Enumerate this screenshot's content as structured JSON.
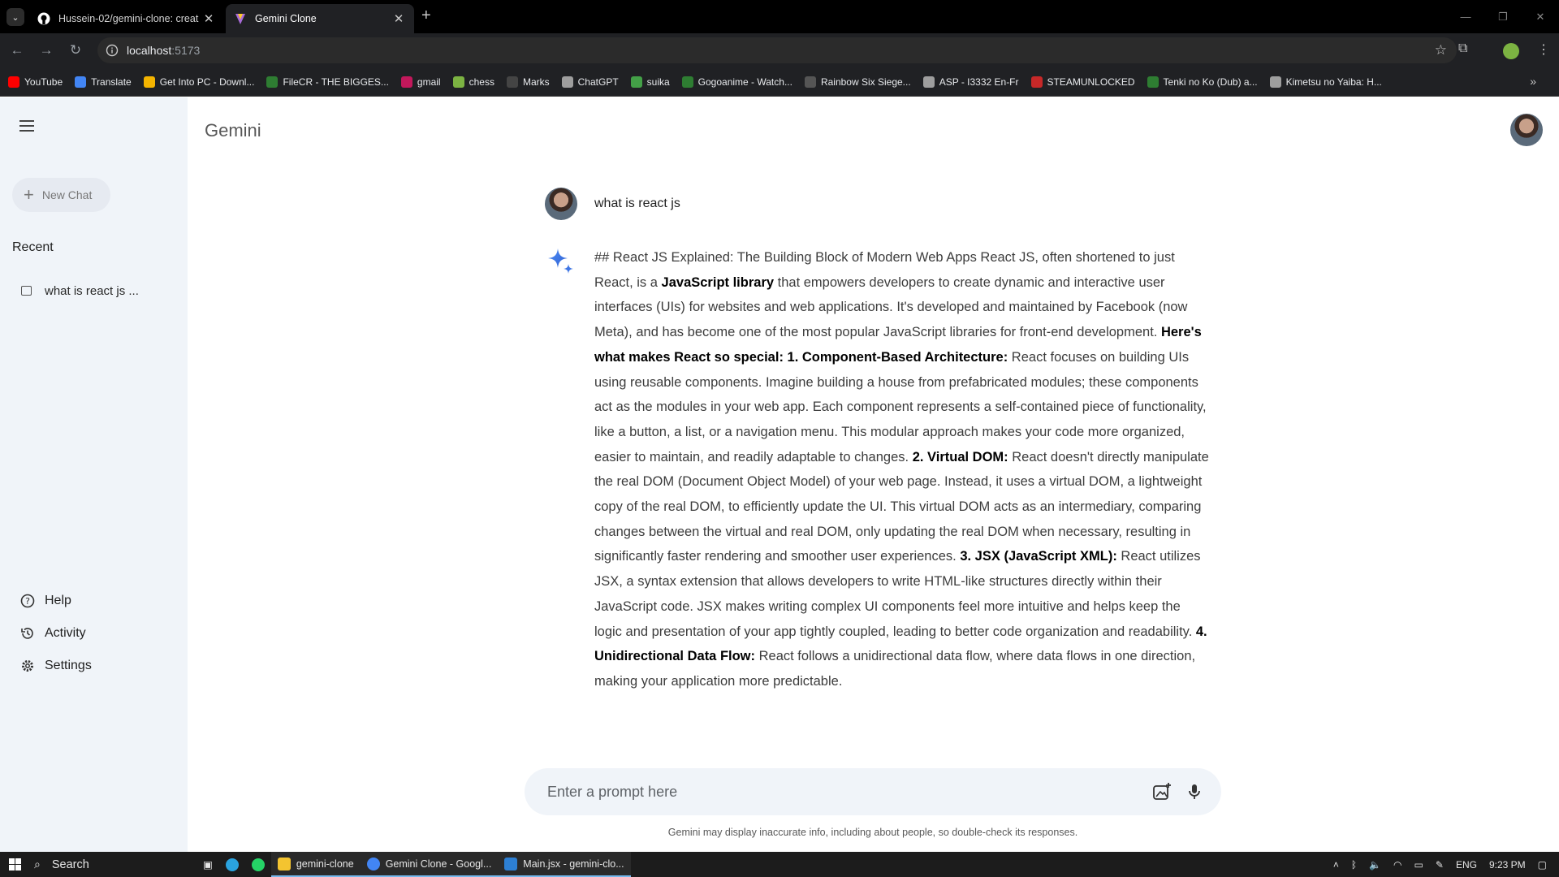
{
  "browser": {
    "tabs": [
      {
        "title": "Hussein-02/gemini-clone: creat",
        "active": false
      },
      {
        "title": "Gemini Clone",
        "active": true
      }
    ],
    "url_host": "localhost",
    "url_port": ":5173",
    "bookmarks": [
      {
        "label": "YouTube",
        "color": "#ff0000"
      },
      {
        "label": "Translate",
        "color": "#4285f4"
      },
      {
        "label": "Get Into PC - Downl...",
        "color": "#f4b400"
      },
      {
        "label": "FileCR - THE BIGGES...",
        "color": "#2e7d32"
      },
      {
        "label": "gmail",
        "color": "#c2185b"
      },
      {
        "label": "chess",
        "color": "#7cb342"
      },
      {
        "label": "Marks",
        "color": "#444444"
      },
      {
        "label": "ChatGPT",
        "color": "#9e9e9e"
      },
      {
        "label": "suika",
        "color": "#43a047"
      },
      {
        "label": "Gogoanime - Watch...",
        "color": "#2e7d32"
      },
      {
        "label": "Rainbow Six Siege...",
        "color": "#555555"
      },
      {
        "label": "ASP - I3332 En-Fr",
        "color": "#9e9e9e"
      },
      {
        "label": "STEAMUNLOCKED",
        "color": "#c62828"
      },
      {
        "label": "Tenki no Ko (Dub) a...",
        "color": "#2e7d32"
      },
      {
        "label": "Kimetsu no Yaiba: H...",
        "color": "#9e9e9e"
      }
    ]
  },
  "sidebar": {
    "new_chat": "New Chat",
    "recent_title": "Recent",
    "recent_items": [
      "what is react js ..."
    ],
    "bottom": {
      "help": "Help",
      "activity": "Activity",
      "settings": "Settings"
    }
  },
  "main": {
    "title": "Gemini",
    "user_prompt": "what is react js",
    "answer_segments": [
      {
        "t": "## React JS Explained: The Building Block of Modern Web Apps React JS, often shortened to just React, is a ",
        "b": false
      },
      {
        "t": "JavaScript library",
        "b": true
      },
      {
        "t": " that empowers developers to create dynamic and interactive user interfaces (UIs) for websites and web applications. It's developed and maintained by Facebook (now Meta), and has become one of the most popular JavaScript libraries for front-end development. ",
        "b": false
      },
      {
        "t": "Here's what makes React so special: 1. Component-Based Architecture:",
        "b": true
      },
      {
        "t": " React focuses on building UIs using reusable components. Imagine building a house from prefabricated modules; these components act as the modules in your web app. Each component represents a self-contained piece of functionality, like a button, a list, or a navigation menu. This modular approach makes your code more organized, easier to maintain, and readily adaptable to changes. ",
        "b": false
      },
      {
        "t": "2. Virtual DOM:",
        "b": true
      },
      {
        "t": " React doesn't directly manipulate the real DOM (Document Object Model) of your web page. Instead, it uses a virtual DOM, a lightweight copy of the real DOM, to efficiently update the UI. This virtual DOM acts as an intermediary, comparing changes between the virtual and real DOM, only updating the real DOM when necessary, resulting in significantly faster rendering and smoother user experiences. ",
        "b": false
      },
      {
        "t": "3. JSX (JavaScript XML):",
        "b": true
      },
      {
        "t": " React utilizes JSX, a syntax extension that allows developers to write HTML-like structures directly within their JavaScript code. JSX makes writing complex UI components feel more intuitive and helps keep the logic and presentation of your app tightly coupled, leading to better code organization and readability. ",
        "b": false
      },
      {
        "t": "4. Unidirectional Data Flow:",
        "b": true
      },
      {
        "t": " React follows a unidirectional data flow, where data flows in one direction, making your application more predictable.",
        "b": false
      }
    ],
    "prompt_placeholder": "Enter a prompt here",
    "disclaimer": "Gemini may display inaccurate info, including about people, so double-check its responses."
  },
  "taskbar": {
    "search": "Search",
    "apps": [
      {
        "label": "gemini-clone",
        "color": "#f4c430"
      },
      {
        "label": "Gemini Clone - Googl...",
        "color": "#4285f4"
      },
      {
        "label": "Main.jsx - gemini-clo...",
        "color": "#2d7fd3"
      }
    ],
    "lang": "ENG",
    "time": "9:23 PM"
  }
}
